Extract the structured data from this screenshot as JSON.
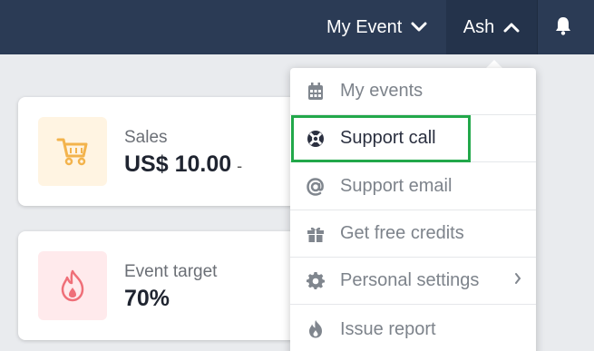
{
  "header": {
    "event_menu_label": "My Event",
    "user_menu_label": "Ash",
    "bell_icon": "bell-icon"
  },
  "cards": [
    {
      "label": "Sales",
      "value": "US$ 10.00",
      "sub": "-",
      "icon": "cart-icon",
      "accent": "#f3b34c"
    },
    {
      "label": "Event target",
      "value": "70%",
      "icon": "flame-icon",
      "accent": "#ef6f78"
    }
  ],
  "user_menu": {
    "items": [
      {
        "label": "My events",
        "icon": "calendar-icon"
      },
      {
        "label": "Support call",
        "icon": "lifebuoy-icon",
        "highlighted": true
      },
      {
        "label": "Support email",
        "icon": "at-icon"
      },
      {
        "label": "Get free credits",
        "icon": "gift-icon"
      },
      {
        "label": "Personal settings",
        "icon": "gear-icon",
        "has_submenu": true
      },
      {
        "label": "Issue report",
        "icon": "flame-icon"
      }
    ]
  },
  "colors": {
    "header_bg": "#2b3b55",
    "page_bg": "#e9ebee",
    "highlight": "#22a84a"
  }
}
